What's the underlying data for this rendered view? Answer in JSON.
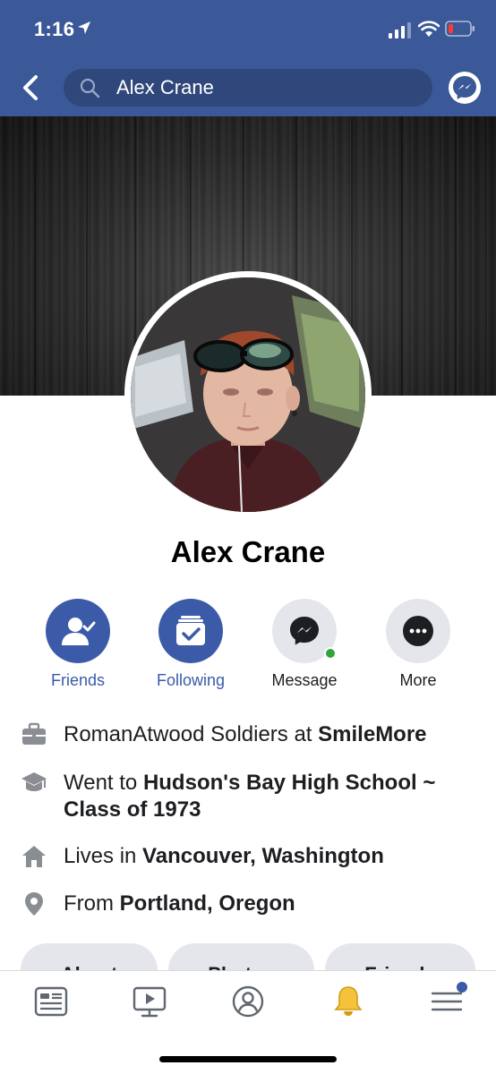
{
  "status_bar": {
    "time": "1:16"
  },
  "header": {
    "search_value": "Alex Crane"
  },
  "profile": {
    "name": "Alex Crane"
  },
  "actions": [
    {
      "label": "Friends"
    },
    {
      "label": "Following"
    },
    {
      "label": "Message"
    },
    {
      "label": "More"
    }
  ],
  "info": {
    "work": {
      "prefix": "RomanAtwood Soldiers at ",
      "place": "SmileMore"
    },
    "education": {
      "prefix": "Went to ",
      "school": "Hudson's Bay High School ~ Class of 1973"
    },
    "lives": {
      "prefix": "Lives in ",
      "place": "Vancouver, Washington"
    },
    "from": {
      "prefix": "From ",
      "place": "Portland, Oregon"
    }
  },
  "tabs": [
    {
      "label": "About"
    },
    {
      "label": "Photos"
    },
    {
      "label": "Friends"
    }
  ],
  "bottom_nav": {
    "icons": [
      "news-feed-icon",
      "watch-icon",
      "profile-icon",
      "notifications-icon",
      "menu-icon"
    ],
    "active": "notifications-icon"
  },
  "colors": {
    "header": "#3b5998",
    "accent": "#3b5ba8",
    "online": "#2ea43b",
    "notification_bell": "#f5c33b"
  }
}
